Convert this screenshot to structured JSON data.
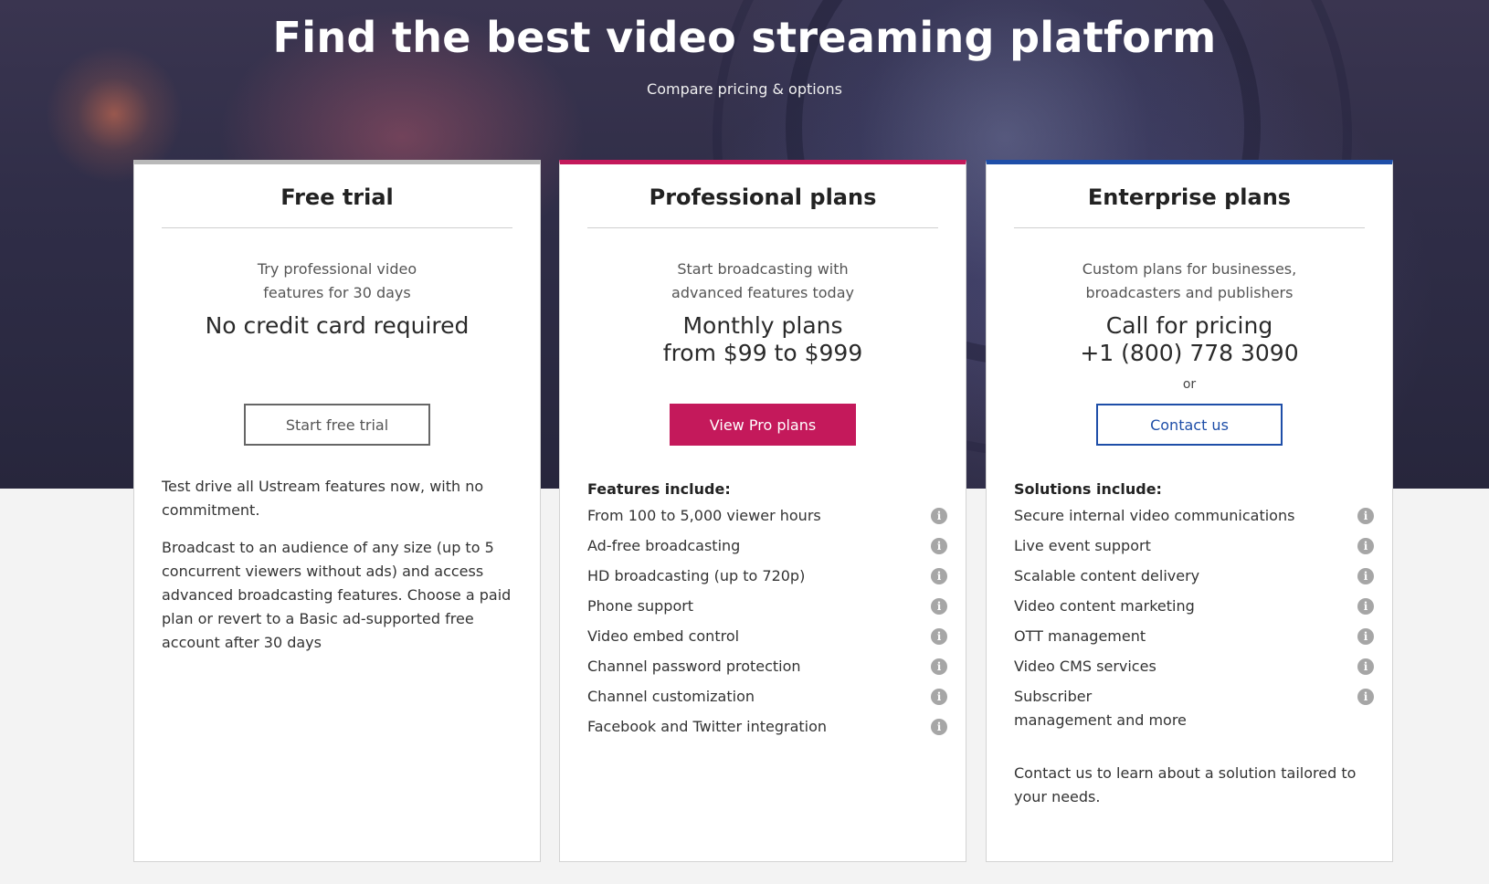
{
  "hero": {
    "title": "Find the best video streaming platform",
    "subtitle": "Compare pricing & options"
  },
  "free_trial": {
    "title": "Free trial",
    "desc_line1": "Try professional video",
    "desc_line2": "features for 30 days",
    "price": "No credit card required",
    "button": "Start free trial",
    "para1": "Test drive all Ustream features now, with no commitment.",
    "para2": "Broadcast to an audience of any size (up to 5 concurrent viewers without ads) and access advanced broadcasting features. Choose a paid plan or revert to a Basic ad-supported free account after 30 days"
  },
  "pro": {
    "title": "Professional plans",
    "desc_line1": "Start broadcasting with",
    "desc_line2": "advanced features today",
    "price_line1": "Monthly plans",
    "price_line2": "from $99 to $999",
    "button": "View Pro plans",
    "list_heading": "Features include:",
    "features": [
      "From 100 to 5,000 viewer hours",
      "Ad-free broadcasting",
      "HD broadcasting (up to 720p)",
      "Phone support",
      "Video embed control",
      "Channel password protection",
      "Channel customization",
      "Facebook and Twitter integration"
    ]
  },
  "enterprise": {
    "title": "Enterprise plans",
    "desc_line1": "Custom plans for businesses,",
    "desc_line2": "broadcasters and publishers",
    "price_line1": "Call for pricing",
    "price_line2": "+1 (800) 778 3090",
    "or": "or",
    "button": "Contact us",
    "list_heading": "Solutions include:",
    "solutions": [
      "Secure internal video communications",
      "Live event support",
      "Scalable content delivery",
      "Video content marketing",
      "OTT management",
      "Video CMS services",
      "Subscriber management and more"
    ],
    "note": "Contact us to learn about a solution tailored to your needs."
  },
  "icons": {
    "info": "info-icon"
  },
  "colors": {
    "pro_accent": "#c4195b",
    "enterprise_accent": "#1e4ea8",
    "free_accent": "#b9b9b9"
  }
}
